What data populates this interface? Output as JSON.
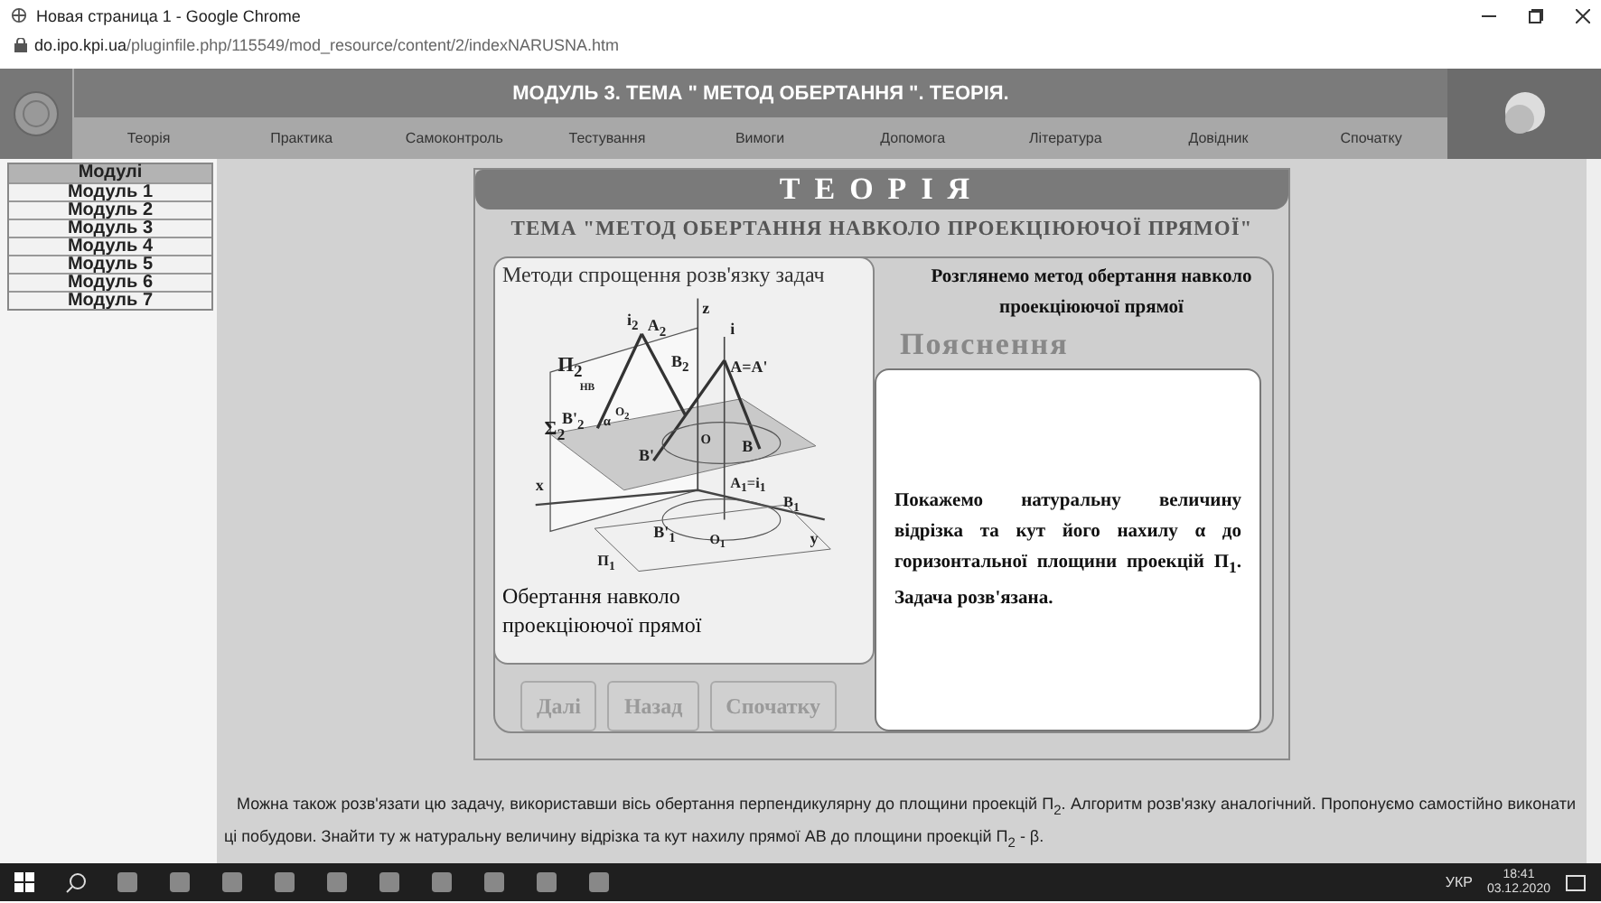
{
  "browser": {
    "title": "Новая страница 1 - Google Chrome",
    "url_host": "do.ipo.kpi.ua",
    "url_path": "/pluginfile.php/115549/mod_resource/content/2/indexNARUSNA.htm"
  },
  "header": {
    "title": "МОДУЛЬ 3. ТЕМА \" МЕТОД ОБЕРТАННЯ \". ТЕОРІЯ.",
    "nav": [
      "Теорія",
      "Практика",
      "Самоконтроль",
      "Тестування",
      "Вимоги",
      "Допомога",
      "Література",
      "Довідник",
      "Спочатку"
    ]
  },
  "modules": {
    "heading": "Модулі",
    "items": [
      "Модуль 1",
      "Модуль 2",
      "Модуль 3",
      "Модуль 4",
      "Модуль 5",
      "Модуль 6",
      "Модуль 7"
    ]
  },
  "card": {
    "title": "ТЕОРІЯ",
    "subtitle": "ТЕМА \"МЕТОД ОБЕРТАННЯ НАВКОЛО ПРОЕКЦІЮЮЧОЇ ПРЯМОЇ\"",
    "figure": {
      "caption_top": "Методи спрощення розв'язку задач",
      "caption_bottom": "Обертання навколо проекціюючої прямої",
      "labels": [
        "z",
        "i$_{2}$",
        "A$_{2}$",
        "i",
        "Π$_{2}$",
        "НВ",
        "B$_{2}$",
        "A=A'",
        "Σ$_{2}$",
        "B'$_{2}$",
        "α",
        "O$_{2}$",
        "O",
        "B",
        "B'",
        "x",
        "A$_{1}$=i$_{1}$",
        "B$_{1}$",
        "O$_{1}$",
        "y",
        "B'$_{1}$",
        "Π$_{1}$"
      ]
    },
    "buttons": [
      {
        "label": "Далі",
        "disabled": true
      },
      {
        "label": "Назад",
        "disabled": true
      },
      {
        "label": "Спочатку",
        "disabled": true
      }
    ],
    "intro": "Розглянемо метод обертання навколо проекціюючої прямої",
    "explanation_heading": "Пояснення",
    "explanation": "Покажемо натуральну величину відрізка та кут його нахилу α до горизонтальної площини проекцій П$_{1}$. Задача розв'язана."
  },
  "note": "Можна також розв'язати цю задачу, використавши вісь обертання перпендикулярну до площини проекцій П$_{2}$. Алгоритм розв'язку аналогічний. Пропонуємо самостійно виконати ці побудови. Знайти ту ж натуральну величину відрізка та кут нахилу прямої АВ до площини проекцій П$_{2}$ - β.",
  "taskbar": {
    "language": "УКР",
    "time": "18:41",
    "date": "03.12.2020"
  }
}
